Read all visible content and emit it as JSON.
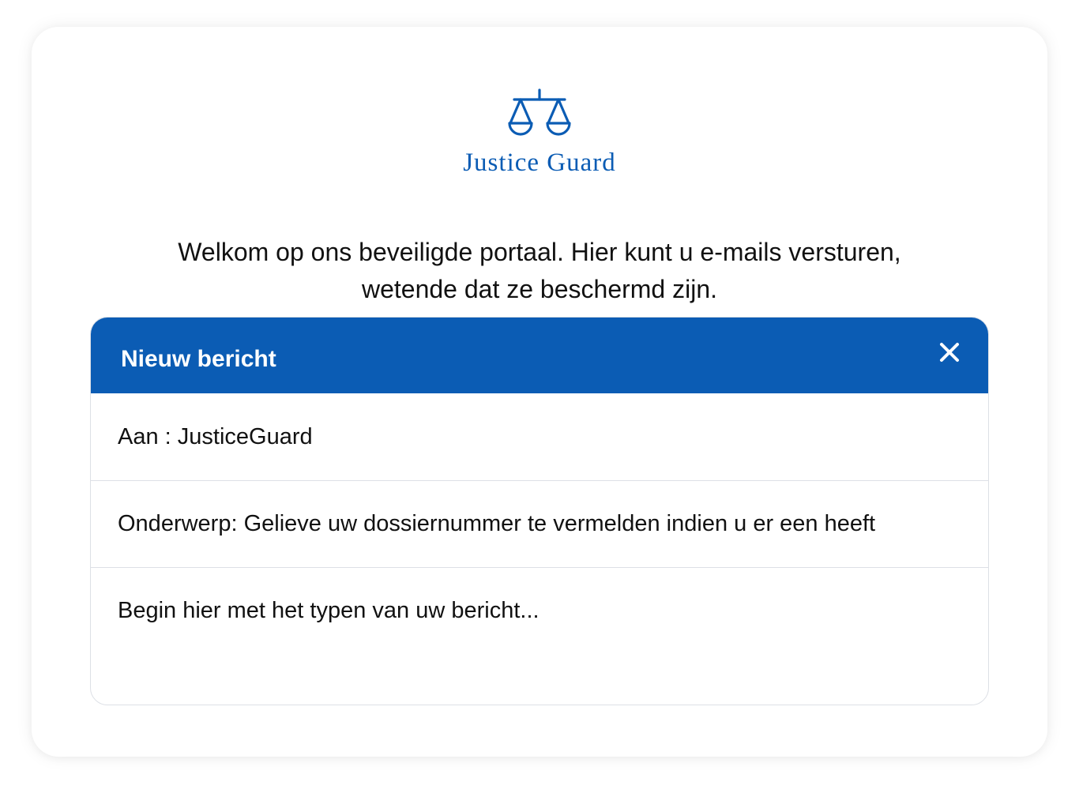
{
  "brand": {
    "name": "Justice Guard",
    "logo_icon": "scales-of-justice-icon",
    "color": "#0b5cb4"
  },
  "welcome": {
    "line1": "Welkom op ons beveiligde portaal. Hier kunt u e-mails versturen,",
    "line2": "wetende dat ze beschermd zijn."
  },
  "compose": {
    "title": "Nieuw bericht",
    "close_icon": "close-icon",
    "header_color": "#0b5cb4",
    "to_field": "Aan : JusticeGuard",
    "subject_field": "Onderwerp: Gelieve uw dossiernummer te vermelden indien u er een heeft",
    "body_placeholder": "Begin hier met het typen van uw bericht..."
  }
}
